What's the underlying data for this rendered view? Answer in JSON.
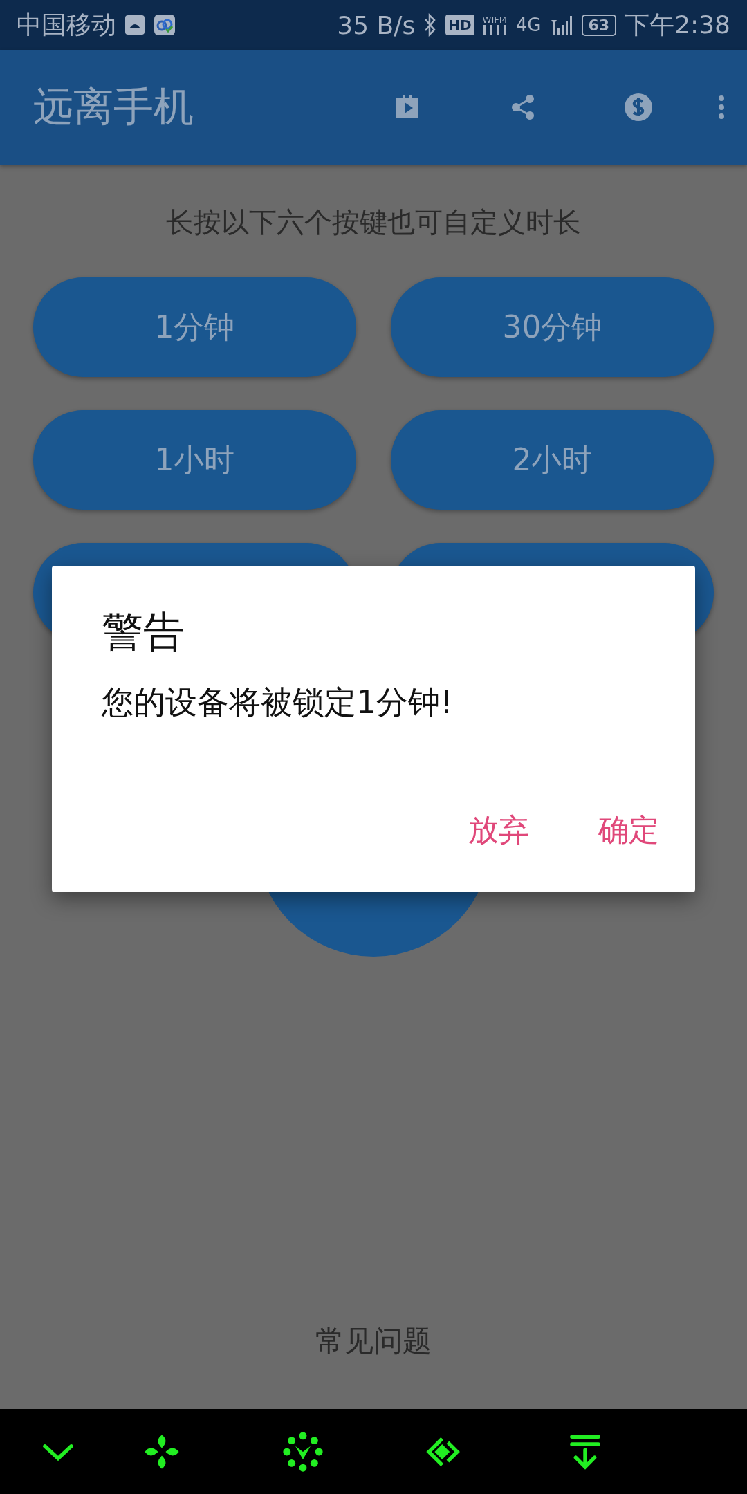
{
  "status_bar": {
    "carrier": "中国移动",
    "speed": "35 B/s",
    "hd": "HD",
    "wifi": "WIFI4",
    "network": "4G",
    "battery": "63",
    "time": "下午2:38"
  },
  "app_bar": {
    "title": "远离手机"
  },
  "hint": "长按以下六个按键也可自定义时长",
  "durations": [
    {
      "kind": "button",
      "label": "1分钟"
    },
    {
      "kind": "button",
      "label": "30分钟"
    },
    {
      "kind": "button",
      "label": "1小时"
    },
    {
      "kind": "button",
      "label": "2小时"
    },
    {
      "kind": "button"
    },
    {
      "kind": "button"
    }
  ],
  "faq": "常见问题",
  "dialog": {
    "title": "警告",
    "message": "您的设备将被锁定1分钟!",
    "buttons": [
      "放弃",
      "确定"
    ]
  }
}
